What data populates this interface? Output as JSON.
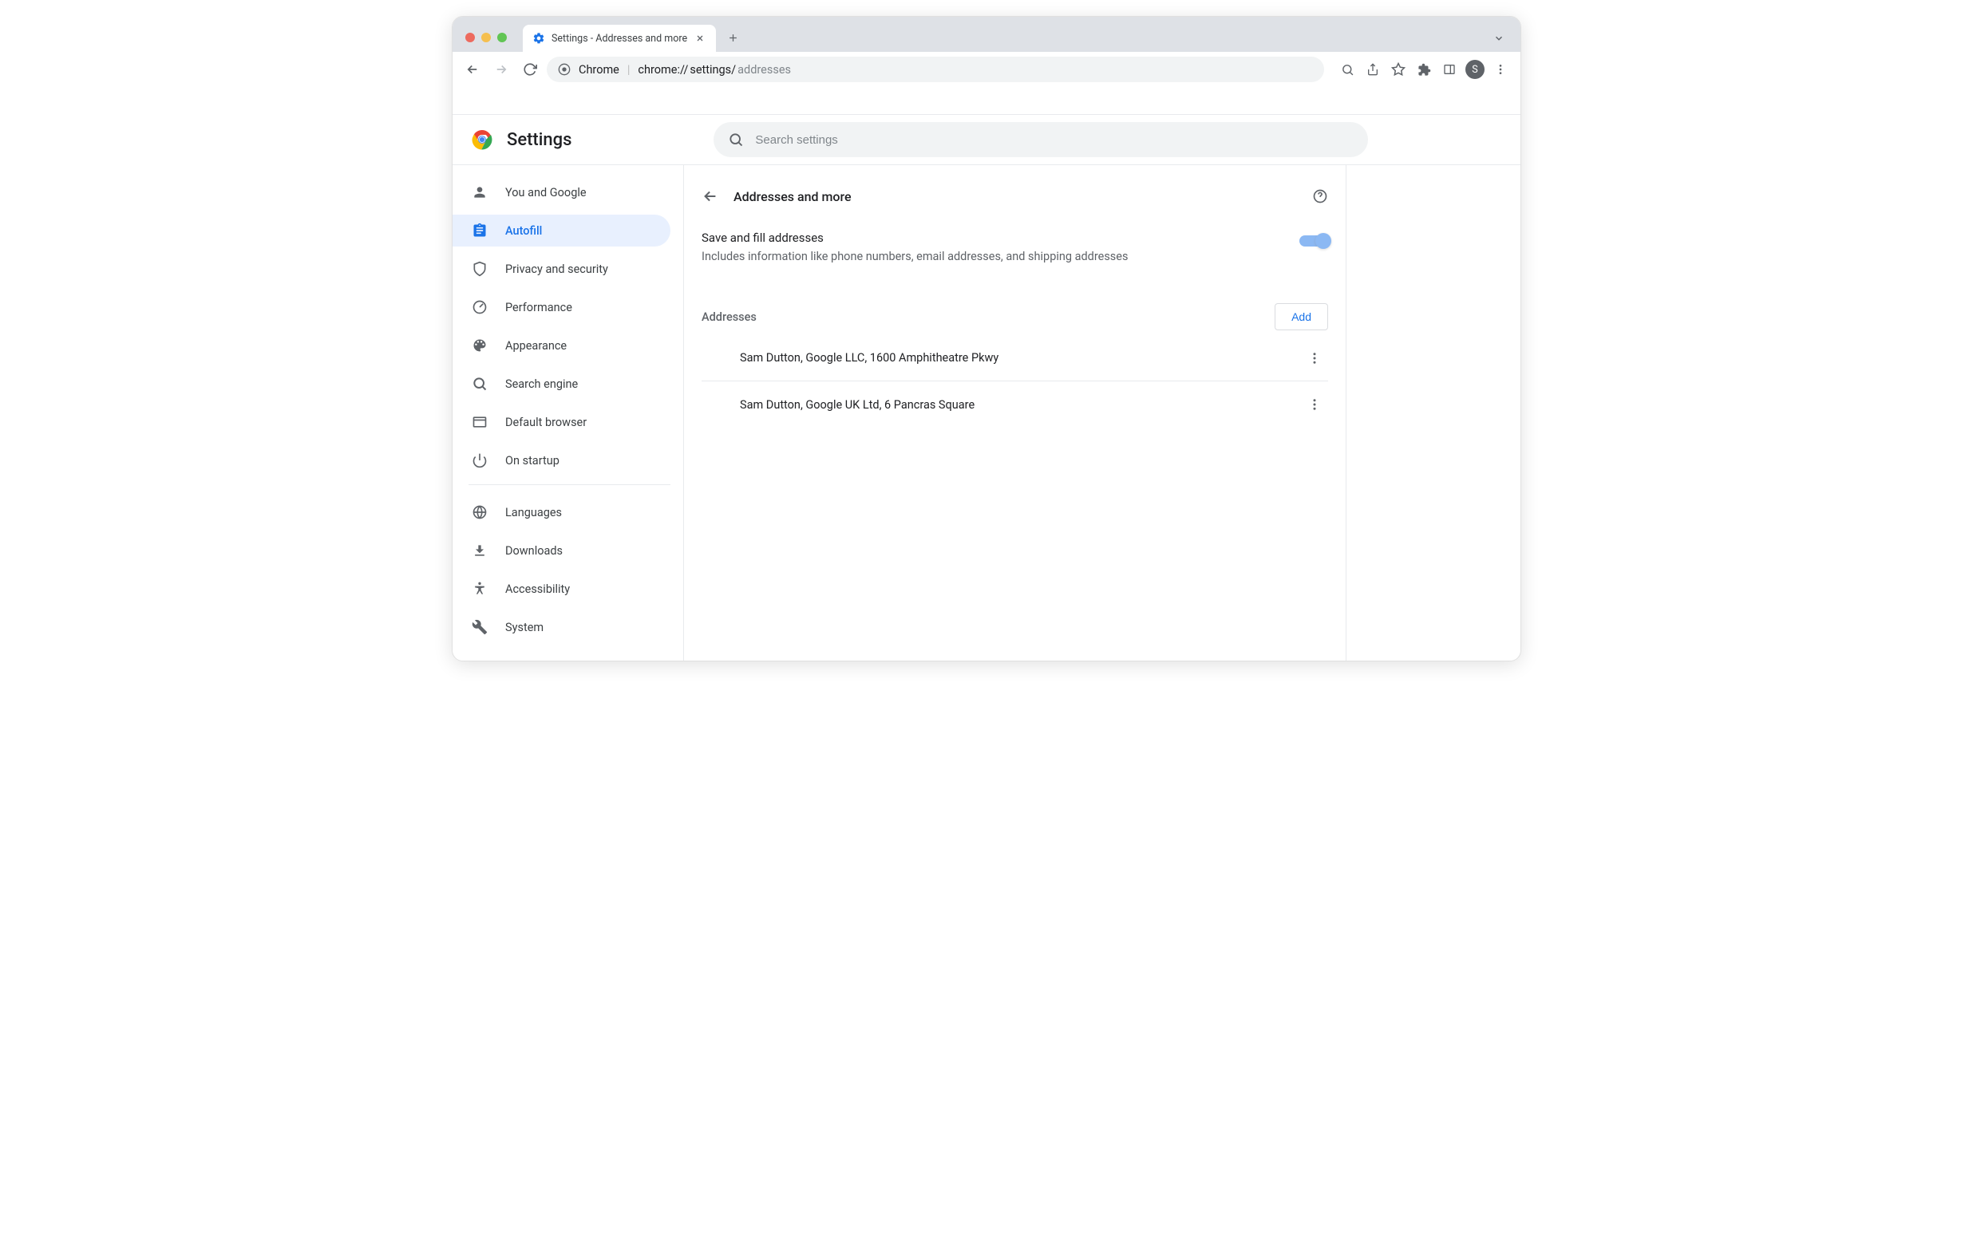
{
  "window": {
    "tab_title": "Settings - Addresses and more",
    "omnibox_prefix": "Chrome",
    "omnibox_url_strong": "chrome://",
    "omnibox_url_mid": "settings/",
    "omnibox_url_dim": "addresses",
    "avatar_initial": "S"
  },
  "header": {
    "title": "Settings",
    "search_placeholder": "Search settings"
  },
  "sidebar": {
    "items": [
      {
        "label": "You and Google"
      },
      {
        "label": "Autofill"
      },
      {
        "label": "Privacy and security"
      },
      {
        "label": "Performance"
      },
      {
        "label": "Appearance"
      },
      {
        "label": "Search engine"
      },
      {
        "label": "Default browser"
      },
      {
        "label": "On startup"
      }
    ],
    "items2": [
      {
        "label": "Languages"
      },
      {
        "label": "Downloads"
      },
      {
        "label": "Accessibility"
      },
      {
        "label": "System"
      }
    ]
  },
  "panel": {
    "title": "Addresses and more",
    "toggle": {
      "title": "Save and fill addresses",
      "desc": "Includes information like phone numbers, email addresses, and shipping addresses"
    },
    "addresses_label": "Addresses",
    "add_label": "Add",
    "addresses": [
      {
        "text": "Sam Dutton, Google LLC, 1600 Amphitheatre Pkwy"
      },
      {
        "text": "Sam Dutton, Google UK Ltd, 6 Pancras Square"
      }
    ]
  }
}
